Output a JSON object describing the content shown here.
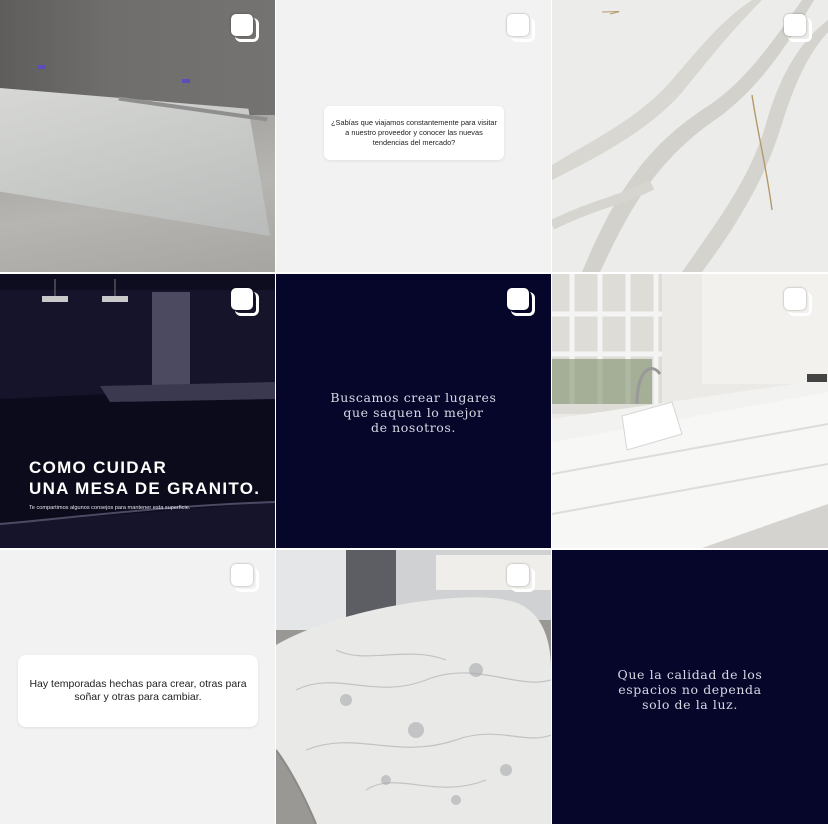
{
  "posts": [
    {
      "id": "post-1",
      "icon": "multiple-images-icon"
    },
    {
      "id": "post-2",
      "icon": "multiple-images-icon",
      "card_text": "¿Sabías que viajamos constantemente para visitar a nuestro proveedor y conocer las nuevas tendencias del mercado?"
    },
    {
      "id": "post-3",
      "icon": "multiple-images-icon"
    },
    {
      "id": "post-4",
      "icon": "multiple-images-icon",
      "title_line_1": "COMO CUIDAR",
      "title_line_2": "UNA MESA DE GRANITO.",
      "subtitle": "Te compartimos algunos consejos para mantener esta superficie."
    },
    {
      "id": "post-5",
      "icon": "multiple-images-icon",
      "quote_line_1": "Buscamos crear lugares",
      "quote_line_2": "que saquen lo mejor",
      "quote_line_3": "de nosotros."
    },
    {
      "id": "post-6",
      "icon": "multiple-images-icon"
    },
    {
      "id": "post-7",
      "icon": "multiple-images-icon",
      "card_line_1": "Hay temporadas hechas para crear,  otras para",
      "card_line_2": "soñar y otras para cambiar."
    },
    {
      "id": "post-8",
      "icon": "multiple-images-icon"
    },
    {
      "id": "post-9",
      "quote_line_1": "Que la calidad de los",
      "quote_line_2": "espacios no dependa",
      "quote_line_3": "solo de la luz."
    }
  ],
  "colors": {
    "navy": "#05062a",
    "card_bg": "#ffffff",
    "light_bg": "#f2f2f2"
  }
}
